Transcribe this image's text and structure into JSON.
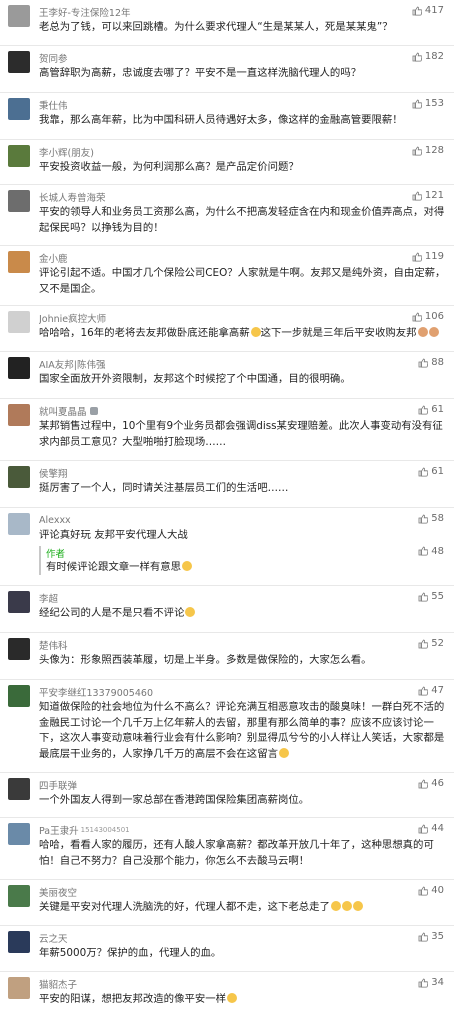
{
  "comments": [
    {
      "name": "王李好-专注保险12年",
      "likes": "417",
      "avatar": "#9a9a9a",
      "text": "老总为了钱，可以来回跳槽。为什么要求代理人“生是某某人，死是某某鬼”？"
    },
    {
      "name": "贺同参",
      "likes": "182",
      "avatar": "#2c2c2c",
      "text": "高管辞职为高薪，忠诚度去哪了？平安不是一直这样洗脑代理人的吗？"
    },
    {
      "name": "秉仕伟",
      "likes": "153",
      "avatar": "#4c6f92",
      "text": "我靠，那么高年薪，比为中国科研人员待遇好太多，像这样的金融高管要限薪！"
    },
    {
      "name": "李小辉(朋友)",
      "likes": "128",
      "avatar": "#5a7a3c",
      "text": "平安投资收益一般，为何利润那么高？是产品定价问题？"
    },
    {
      "name": "长城人寿曾海荣",
      "likes": "121",
      "avatar": "#6d6d6d",
      "text": "平安的领导人和业务员工资那么高，为什么不把高发轻症含在内和现金价值弄高点，对得起保民吗？以挣钱为目的！"
    },
    {
      "name": "金小鹿",
      "likes": "119",
      "avatar": "#c98a4a",
      "text": "评论引起不适。中国才几个保险公司CEO？人家就是牛啊。友邦又是纯外资，自由定薪，又不是国企。"
    },
    {
      "name": "Johnie疯控大师",
      "likes": "106",
      "avatar": "#d0d0d0",
      "text": "哈哈哈，16年的老将去友邦做卧底还能拿高薪",
      "text2": "这下一步就是三年后平安收购友邦"
    },
    {
      "name": "AIA友邦|陈伟强",
      "likes": "88",
      "avatar": "#222222",
      "text": "国家全面放开外资限制，友邦这个时候挖了个中国通，目的很明确。"
    },
    {
      "name": "就叫夏晶晶",
      "likes": "61",
      "avatar": "#b07a5a",
      "text": "某邦销售过程中，10个里有9个业务员都会强调diss某安理赔差。此次人事变动有没有征求内部员工意见？大型啪啪打脸现场……"
    },
    {
      "name": "侯擎翔",
      "likes": "61",
      "avatar": "#4a5a3a",
      "text": "挺厉害了一个人，同时请关注基层员工们的生活吧……"
    },
    {
      "name": "Alexxx",
      "likes": "58",
      "avatar": "#a8b8c8",
      "text": "评论真好玩 友邦平安代理人大战",
      "reply_author": "作者",
      "reply_likes": "48",
      "reply_text": "有时候评论跟文章一样有意思"
    },
    {
      "name": "李超",
      "likes": "55",
      "avatar": "#3a3a4a",
      "text": "经纪公司的人是不是只看不评论"
    },
    {
      "name": "楚伟科",
      "likes": "52",
      "avatar": "#2a2a2a",
      "text": "头像为：形象照西装革履，切是上半身。多数是做保险的，大家怎么看。"
    },
    {
      "name": "平安李继红13379005460",
      "likes": "47",
      "avatar": "#3a6a3a",
      "text": "知道做保险的社会地位为什么不高么？评论充满互相恶意攻击的酸臭味！一群白死不活的金融民工讨论一个几千万上亿年薪人的去留，那里有那么简单的事？应该不应该讨论一下，这次人事变动意味着行业会有什么影响？别显得瓜兮兮的小人样让人笑话，大家都是最底层干业务的，人家挣几千万的高层不会在这留言"
    },
    {
      "name": "四手联弹",
      "likes": "46",
      "avatar": "#3a3a3a",
      "text": "一个外国友人得到一家总部在香港跨国保险集团高薪岗位。"
    },
    {
      "name": "Pa王隶升",
      "name_tag": "15143004501",
      "likes": "44",
      "avatar": "#6a8aa8",
      "text": "哈哈，看看人家的履历，还有人酸人家拿高薪？都改革开放几十年了，这种思想真的可怕！自己不努力？自己没那个能力，你怎么不去酸马云啊！"
    },
    {
      "name": "美丽夜空",
      "likes": "40",
      "avatar": "#4a7a4a",
      "text": "关键是平安对代理人洗脑洗的好，代理人都不走，这下老总走了"
    },
    {
      "name": "云之天",
      "likes": "35",
      "avatar": "#2a3a5a",
      "text": "年薪5000万？保护的血，代理人的血。"
    },
    {
      "name": "猫貂杰子",
      "likes": "34",
      "avatar": "#c0a080",
      "text": "平安的阳谋，想把友邦改造的像平安一样"
    }
  ]
}
